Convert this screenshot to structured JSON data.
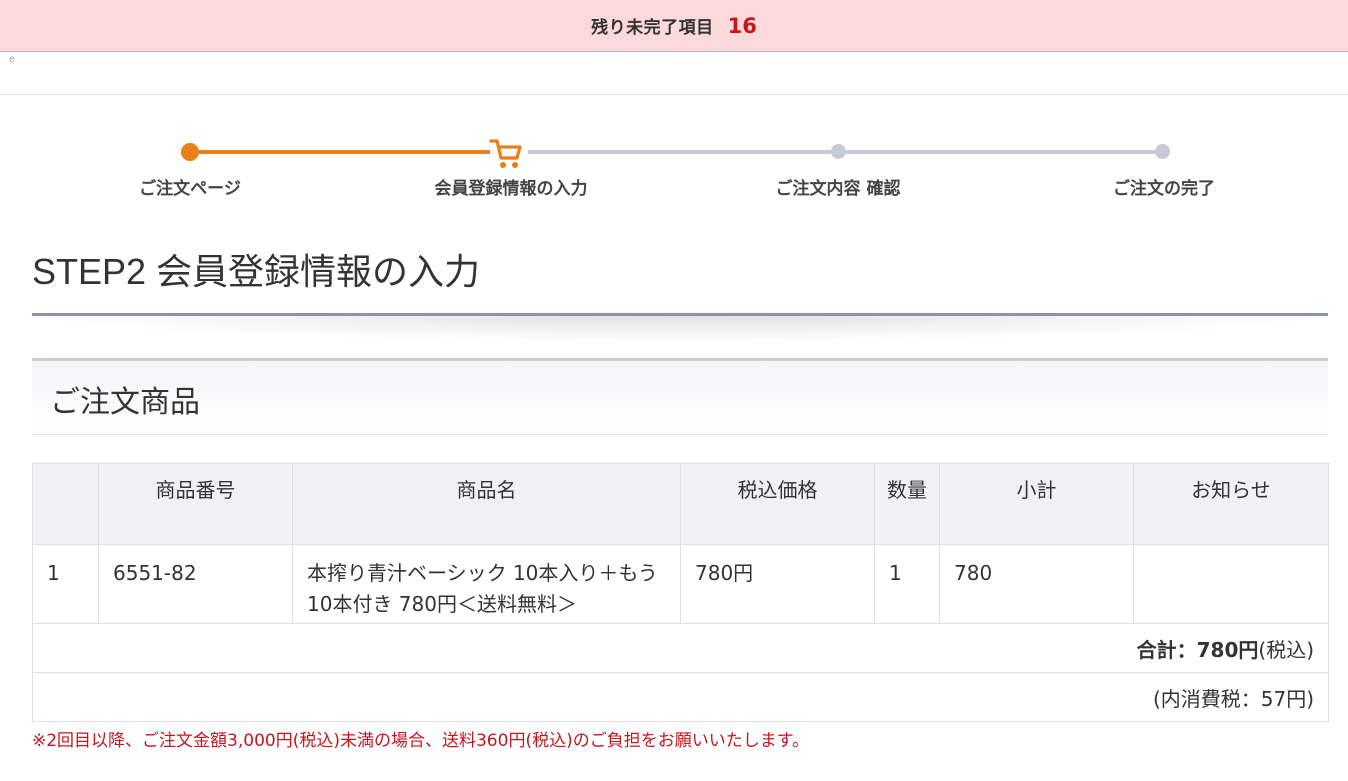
{
  "top_bar": {
    "label": "残り未完了項目",
    "count": "16"
  },
  "corner_mark": "e",
  "progress": {
    "steps": [
      {
        "label": "ご注文ページ"
      },
      {
        "label": "会員登録情報の入力"
      },
      {
        "label": "ご注文内容 確認"
      },
      {
        "label": "ご注文の完了"
      }
    ],
    "colors": {
      "active": "#e87f17",
      "inactive": "#c5cad3"
    },
    "current_icon": "cart-icon"
  },
  "page_title": "STEP2 会員登録情報の入力",
  "section_title": "ご注文商品",
  "table": {
    "headers": [
      "",
      "商品番号",
      "商品名",
      "税込価格",
      "数量",
      "小計",
      "お知らせ"
    ],
    "rows": [
      {
        "no": "1",
        "code": "6551-82",
        "name": "本搾り青汁ベーシック 10本入り＋もう10本付き 780円＜送料無料＞",
        "price": "780円",
        "qty": "1",
        "subtotal": "780",
        "notice": ""
      }
    ],
    "total_label": "合計：",
    "total_value": "780円",
    "total_suffix": "(税込)",
    "tax_note": "(内消費税：57円)"
  },
  "notice_text": "※2回目以降、ご注文金額3,000円(税込)未満の場合、送料360円(税込)のご負担をお願いいたします。"
}
